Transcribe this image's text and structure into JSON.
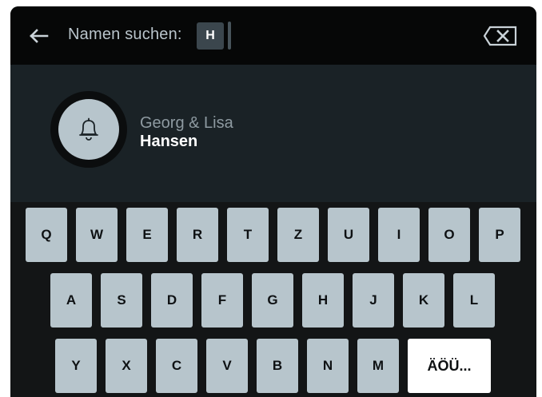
{
  "header": {
    "search_label": "Namen suchen:",
    "query": "H",
    "back_icon": "arrow-left-icon",
    "delete_icon": "backspace-icon"
  },
  "results": [
    {
      "first_names": "Georg & Lisa",
      "last_name": "Hansen",
      "icon": "bell-icon"
    }
  ],
  "keyboard": {
    "row1": [
      "Q",
      "W",
      "E",
      "R",
      "T",
      "Z",
      "U",
      "I",
      "O",
      "P"
    ],
    "row2": [
      "A",
      "S",
      "D",
      "F",
      "G",
      "H",
      "J",
      "K",
      "L"
    ],
    "row3": [
      "Y",
      "X",
      "C",
      "V",
      "B",
      "N",
      "M"
    ],
    "special_key": "ÄÖÜ..."
  },
  "colors": {
    "background": "#131516",
    "topbar": "#060707",
    "results_panel": "#1a2226",
    "key": "#b7c5cc",
    "special_key": "#ffffff"
  }
}
